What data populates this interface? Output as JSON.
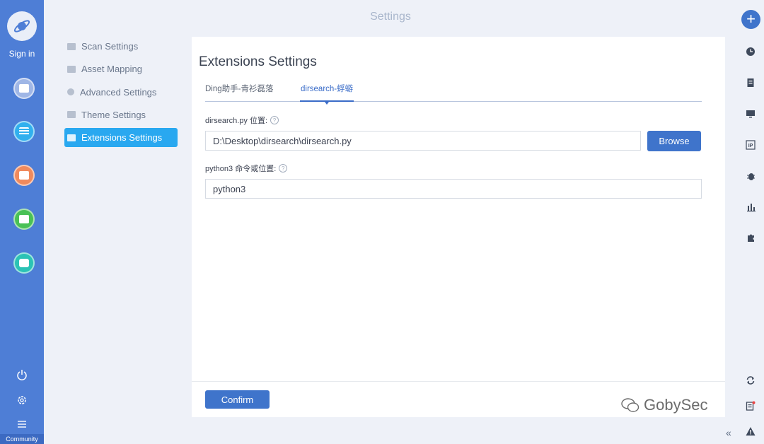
{
  "window": {
    "title": "Settings"
  },
  "left_rail": {
    "sign_in_label": "Sign in",
    "community_label": "Community",
    "items": [
      {
        "icon": "scan-icon",
        "color": "#9fb6e6"
      },
      {
        "icon": "list-icon",
        "color": "#31b0ee"
      },
      {
        "icon": "bug-icon",
        "color": "#f08a5d"
      },
      {
        "icon": "chart-icon",
        "color": "#49c155"
      },
      {
        "icon": "plugin-icon",
        "color": "#2bc3b5"
      }
    ],
    "bottom_icons": [
      "power-icon",
      "gear-icon",
      "menu-icon"
    ]
  },
  "settings_nav": {
    "items": [
      {
        "label": "Scan Settings",
        "icon": "monitor-icon",
        "active": false
      },
      {
        "label": "Asset Mapping",
        "icon": "layers-icon",
        "active": false
      },
      {
        "label": "Advanced Settings",
        "icon": "sun-icon",
        "active": false
      },
      {
        "label": "Theme Settings",
        "icon": "shirt-icon",
        "active": false
      },
      {
        "label": "Extensions Settings",
        "icon": "folder-icon",
        "active": true
      }
    ]
  },
  "main": {
    "heading": "Extensions Settings",
    "tabs": [
      {
        "label": "Ding助手-青衫磊落",
        "active": false
      },
      {
        "label": "dirsearch-蜉蝣",
        "active": true
      }
    ],
    "fields": [
      {
        "label": "dirsearch.py 位置:",
        "value": "D:\\Desktop\\dirsearch\\dirsearch.py"
      },
      {
        "label": "python3 命令或位置:",
        "value": "python3"
      }
    ],
    "browse_label": "Browse",
    "confirm_label": "Confirm"
  },
  "right_rail": {
    "add_icon": "plus-icon",
    "icons": [
      "clock-icon",
      "document-icon",
      "monitor-icon",
      "ip-icon",
      "bug-icon",
      "bar-chart-icon",
      "puzzle-icon",
      "refresh-icon",
      "report-icon",
      "collapse-icon",
      "warning-icon"
    ],
    "ip_label": "IP"
  },
  "watermark": {
    "text": "GobySec"
  },
  "colors": {
    "primary": "#3f74cb",
    "active_nav": "#29a8f0",
    "left_rail": "#4e7ed6"
  }
}
